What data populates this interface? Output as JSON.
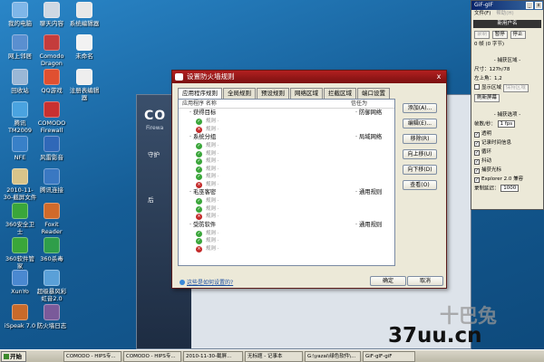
{
  "desktop_icons": [
    {
      "label": "我的电脑",
      "color": "#7fb6e8"
    },
    {
      "label": "聊天内容",
      "color": "#cfd8e3"
    },
    {
      "label": "系统编辑器",
      "color": "#e8e8e8"
    },
    {
      "label": "网上邻居",
      "color": "#5a8fd0"
    },
    {
      "label": "Comodo Dragon",
      "color": "#c43c3c"
    },
    {
      "label": "未命名",
      "color": "#f2f2f2"
    },
    {
      "label": "回收站",
      "color": "#9ab7d6"
    },
    {
      "label": "QQ游戏",
      "color": "#e05030"
    },
    {
      "label": "注册表编辑器",
      "color": "#eeeeee"
    },
    {
      "label": "腾讯TM2009",
      "color": "#4aa3e0"
    },
    {
      "label": "COMODO Firewall",
      "color": "#c83030"
    },
    {
      "label": "NFE",
      "color": "#3880c8"
    },
    {
      "label": "风雷影音",
      "color": "#3068b8"
    },
    {
      "label": "2010-11-30-截屏文件",
      "color": "#d8c48a"
    },
    {
      "label": "腾讯连接",
      "color": "#3a78c2"
    },
    {
      "label": "360安全卫士",
      "color": "#3aa63a"
    },
    {
      "label": "Foxit Reader",
      "color": "#d06a2a"
    },
    {
      "label": "360软件管家",
      "color": "#3aa63a"
    },
    {
      "label": "360杀毒",
      "color": "#2f9e4a"
    },
    {
      "label": "XunYo",
      "color": "#4a88d0"
    },
    {
      "label": "超级暴风彩虹音2.0",
      "color": "#5aa0d8"
    },
    {
      "label": "iSpeak 7.0",
      "color": "#c86a2a"
    },
    {
      "label": "防火墙日志",
      "color": "#7a5a9a"
    }
  ],
  "bg_window": {
    "brand": "CO",
    "brand_sub": "Firewa",
    "side_item_1": "守护",
    "side_item_2": "后"
  },
  "dialog": {
    "title": "设置防火墙规则",
    "close": "x",
    "tabs": [
      "应用程序规则",
      "全局规则",
      "预设规则",
      "网络区域",
      "拦截区域",
      "端口设置"
    ],
    "col_app": "应用程序 名称",
    "col_policy": "信任为",
    "groups": [
      {
        "name": "· 获得目标",
        "policy": "· 防御网络",
        "rules": [
          "ok",
          "no"
        ]
      },
      {
        "name": "· 系统分组",
        "policy": "· 局域网络",
        "rules": [
          "ok",
          "ok",
          "ok",
          "ok",
          "ok",
          "no"
        ]
      },
      {
        "name": "· 毛巫客密",
        "policy": "· 通用规则",
        "rules": [
          "ok",
          "ok",
          "no"
        ]
      },
      {
        "name": "· 受防软件",
        "policy": "· 通用规则",
        "rules": [
          "ok",
          "ok",
          "no"
        ]
      }
    ],
    "rule_text": "规则 ·",
    "buttons": [
      "添加(A)...",
      "编辑(E)...",
      "移除(R)",
      "向上移(U)",
      "向下移(D)",
      "查看(O)"
    ],
    "link": "这些是如何设置的?",
    "ok": "确定",
    "cancel": "取消"
  },
  "gif_panel": {
    "title": "GiF-gIF",
    "menu_file": "文件(F)",
    "menu_other": "帮助(H)",
    "new_name": "新用户名",
    "btn_record": "录制",
    "btn_pause": "暂停",
    "btn_stop": "停止",
    "frames": "0 帧 (0 字节)",
    "capture_area_title": "- 捕获区域 -",
    "size": "尺寸：127h/78",
    "topleft": "左上角：1,2",
    "show_area": "显示区域",
    "maintain_area": "保持区域",
    "refresh": "刷新屏幕",
    "capture_opts_title": "- 捕获选项 -",
    "fps_label": "帧数/秒：",
    "fps_value": "1 fps",
    "opts": [
      "透明",
      "记录时间信息",
      "循环",
      "抖动",
      "捕获光标",
      "Explorer 2.0 兼容"
    ],
    "delay_label": "录制延迟：",
    "delay_value": "1000"
  },
  "taskbar": {
    "start": "开始",
    "tasks": [
      "COMODO - HIPS专...",
      "COMODO - HIPS专...",
      "2010-11-30-截屏...",
      "无标题 - 记事本",
      "G:\\yazai\\绿色软件\\...",
      "GiF-gIF-giF"
    ]
  },
  "watermark": "37uu.cn",
  "watermark_small": "十巴兔"
}
